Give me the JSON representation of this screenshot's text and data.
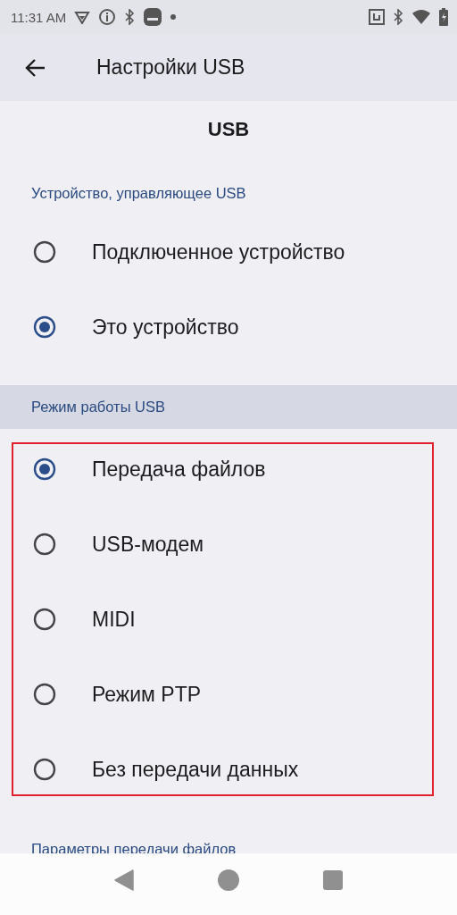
{
  "status_bar": {
    "time": "11:31 AM"
  },
  "app_bar": {
    "title": "Настройки USB"
  },
  "heading": "USB",
  "sections": [
    {
      "title": "Устройство, управляющее USB",
      "kind": "plain",
      "highlighted": false,
      "options": [
        {
          "label": "Подключенное устройство",
          "selected": false
        },
        {
          "label": "Это устройство",
          "selected": true
        }
      ]
    },
    {
      "title": "Режим работы USB",
      "kind": "band",
      "highlighted": true,
      "options": [
        {
          "label": "Передача файлов",
          "selected": true
        },
        {
          "label": "USB-модем",
          "selected": false
        },
        {
          "label": "MIDI",
          "selected": false
        },
        {
          "label": "Режим PTP",
          "selected": false
        },
        {
          "label": "Без передачи данных",
          "selected": false
        }
      ]
    }
  ],
  "next_section_title": "Параметры передачи файлов"
}
